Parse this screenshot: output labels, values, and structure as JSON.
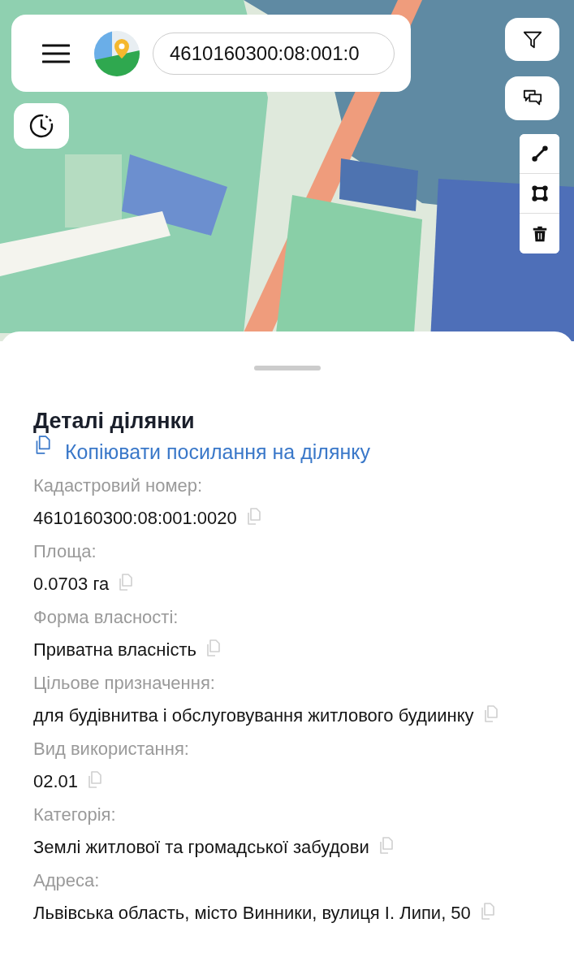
{
  "header": {
    "search": {
      "value": "4610160300:08:001:0"
    }
  },
  "details": {
    "title": "Деталі ділянки",
    "copy_link": "Копіювати посилання на ділянку",
    "fields": [
      {
        "label": "Кадастровий номер:",
        "value": "4610160300:08:001:0020"
      },
      {
        "label": "Площа:",
        "value": "0.0703 га"
      },
      {
        "label": "Форма власності:",
        "value": "Приватна власність"
      },
      {
        "label": "Цільове призначення:",
        "value": "для будівнитва і обслуговування житлового будиинку"
      },
      {
        "label": "Вид використання:",
        "value": "02.01"
      },
      {
        "label": "Категорія:",
        "value": "Землі житлової та громадської забудови"
      },
      {
        "label": "Адреса:",
        "value": "Львівська область, місто Винники, вулиця І. Липи, 50"
      }
    ]
  }
}
